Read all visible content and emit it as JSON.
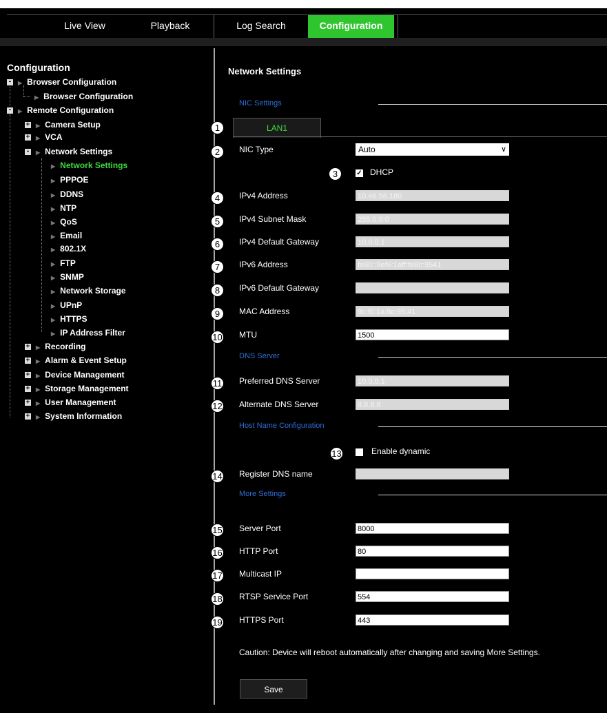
{
  "nav": {
    "tabs": [
      "Live View",
      "Playback",
      "Log Search",
      "Configuration"
    ],
    "active": "Configuration"
  },
  "sidebar": {
    "title": "Configuration",
    "tree": [
      {
        "label": "Browser Configuration",
        "expander": "-"
      },
      {
        "label": "Browser Configuration"
      },
      {
        "label": "Remote Configuration",
        "expander": "-"
      },
      {
        "label": "Camera Setup",
        "expander": "+"
      },
      {
        "label": "VCA",
        "expander": "+"
      },
      {
        "label": "Network Settings",
        "expander": "-"
      },
      {
        "label": "Network Settings",
        "selected": true
      },
      {
        "label": "PPPOE"
      },
      {
        "label": "DDNS"
      },
      {
        "label": "NTP"
      },
      {
        "label": "QoS"
      },
      {
        "label": "Email"
      },
      {
        "label": "802.1X"
      },
      {
        "label": "FTP"
      },
      {
        "label": "SNMP"
      },
      {
        "label": "Network Storage"
      },
      {
        "label": "UPnP"
      },
      {
        "label": "HTTPS"
      },
      {
        "label": "IP Address Filter"
      },
      {
        "label": "Recording",
        "expander": "+"
      },
      {
        "label": "Alarm & Event Setup",
        "expander": "+"
      },
      {
        "label": "Device Management",
        "expander": "+"
      },
      {
        "label": "Storage Management",
        "expander": "+"
      },
      {
        "label": "User Management",
        "expander": "+"
      },
      {
        "label": "System Information",
        "expander": "+"
      }
    ]
  },
  "main": {
    "title": "Network Settings",
    "sections": {
      "nic": "NIC Settings",
      "dns": "DNS Server",
      "host": "Host Name Configuration",
      "more": "More Settings"
    },
    "lan_tab": "LAN1",
    "nic_type": {
      "label": "NIC Type",
      "value": "Auto"
    },
    "dhcp": {
      "label": "DHCP",
      "checked": true,
      "mark": "✓"
    },
    "ipv4_address": {
      "label": "IPv4 Address",
      "value": "10.46.56.180"
    },
    "ipv4_mask": {
      "label": "IPv4 Subnet Mask",
      "value": "255.0.0.0"
    },
    "ipv4_gateway": {
      "label": "IPv4 Default Gateway",
      "value": "10.0.0.1"
    },
    "ipv6_address": {
      "label": "IPv6 Address",
      "value": "fe80::9ef6:1aff:fe8c:9541"
    },
    "ipv6_gateway": {
      "label": "IPv6 Default Gateway",
      "value": ""
    },
    "mac": {
      "label": "MAC Address",
      "value": "9c:f6:1a:8c:95:41"
    },
    "mtu": {
      "label": "MTU",
      "value": "1500"
    },
    "preferred_dns": {
      "label": "Preferred DNS Server",
      "value": "10.0.0.1"
    },
    "alternate_dns": {
      "label": "Alternate DNS Server",
      "value": "8.8.8.8"
    },
    "enable_dynamic": {
      "label": "Enable dynamic",
      "checked": false
    },
    "register_dns": {
      "label": "Register DNS name",
      "value": ""
    },
    "server_port": {
      "label": "Server Port",
      "value": "8000"
    },
    "http_port": {
      "label": "HTTP Port",
      "value": "80"
    },
    "multicast_ip": {
      "label": "Multicast IP",
      "value": ""
    },
    "rtsp_port": {
      "label": "RTSP Service Port",
      "value": "554"
    },
    "https_port": {
      "label": "HTTPS Port",
      "value": "443"
    },
    "caution": "Caution: Device will reboot automatically after changing and saving More Settings.",
    "save": "Save"
  },
  "callouts": [
    "1",
    "2",
    "3",
    "4",
    "5",
    "6",
    "7",
    "8",
    "9",
    "10",
    "11",
    "12",
    "13",
    "14",
    "15",
    "16",
    "17",
    "18",
    "19"
  ],
  "colors": {
    "accent_green": "#2fc52f",
    "section_blue": "#2f6ed6",
    "background": "#000000"
  }
}
